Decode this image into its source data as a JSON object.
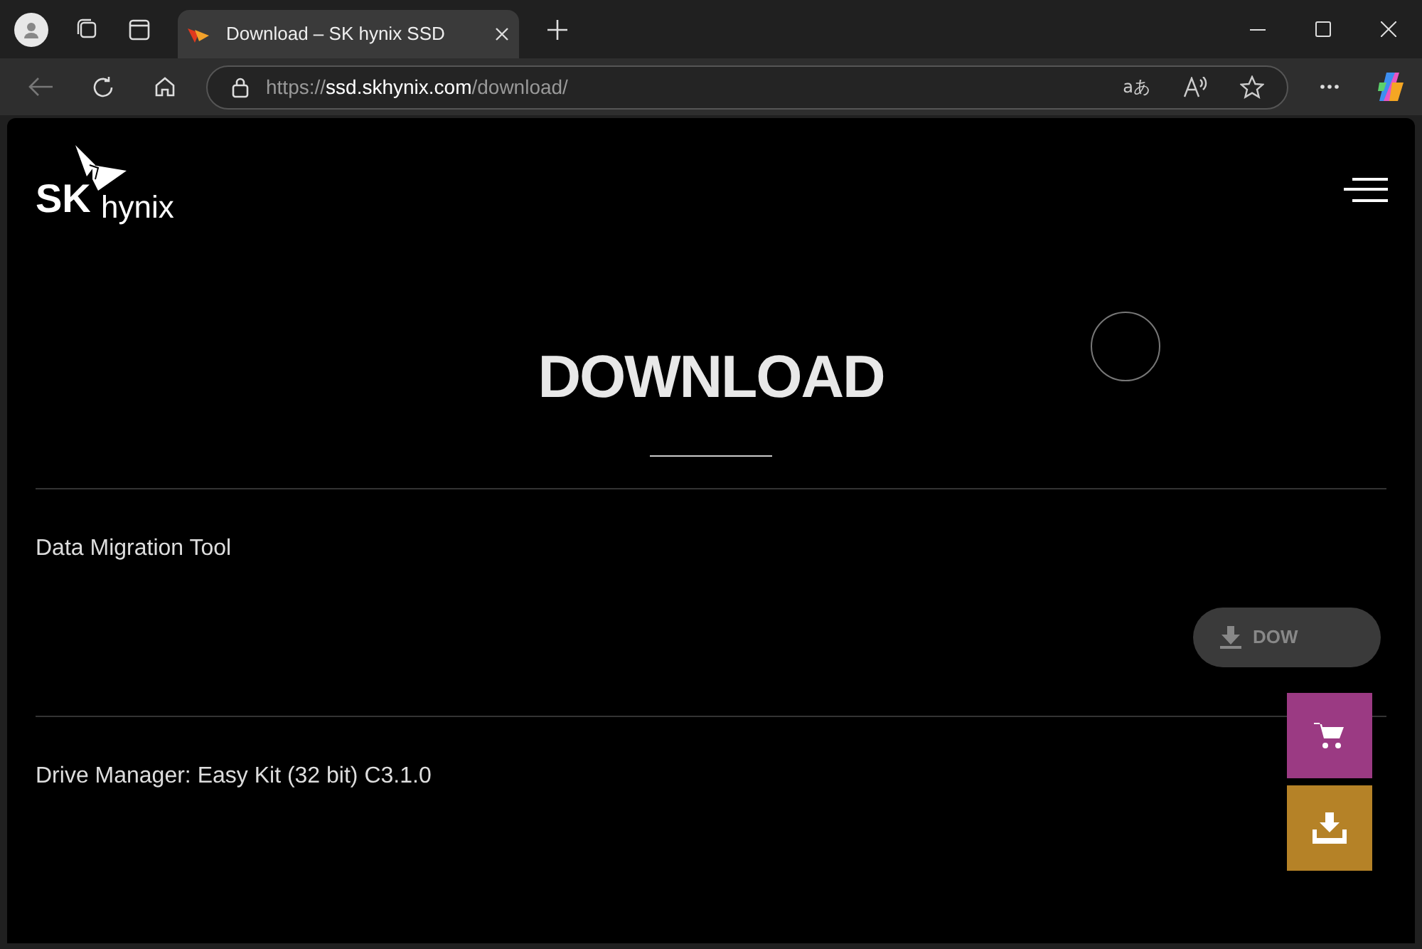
{
  "browser": {
    "tab": {
      "title": "Download – SK hynix SSD",
      "selected": true
    },
    "address": {
      "scheme": "https://",
      "host": "ssd.skhynix.com",
      "path": "/download/"
    },
    "translate_button": "aあ"
  },
  "logo": {
    "brand": "SK",
    "name": "hynix"
  },
  "page": {
    "title": "DOWNLOAD"
  },
  "downloads": [
    {
      "name": "Data Migration Tool",
      "button": "DOW"
    },
    {
      "name": "Drive Manager: Easy Kit (32 bit) C3.1.0"
    }
  ]
}
